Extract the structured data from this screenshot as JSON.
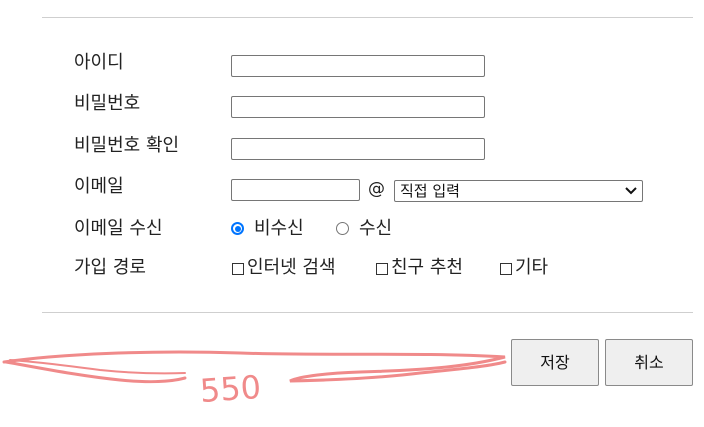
{
  "form": {
    "fields": {
      "id_label": "아이디",
      "password_label": "비밀번호",
      "password_confirm_label": "비밀번호 확인",
      "email_label": "이메일",
      "email_receive_label": "이메일 수신",
      "signup_route_label": "가입 경로"
    },
    "email": {
      "at_sign": "@",
      "domain_select_value": "직접 입력"
    },
    "email_receive": {
      "options": [
        "비수신",
        "수신"
      ],
      "selected": "비수신"
    },
    "signup_route": {
      "options": [
        "인터넷 검색",
        "친구 추천",
        "기타"
      ],
      "checked": []
    }
  },
  "buttons": {
    "save_label": "저장",
    "cancel_label": "취소"
  },
  "annotation": {
    "text": "550",
    "color": "#f08a8a"
  },
  "colors": {
    "radio_accent": "#0075ff",
    "button_bg": "#efefef",
    "divider": "#cfcfcf"
  }
}
